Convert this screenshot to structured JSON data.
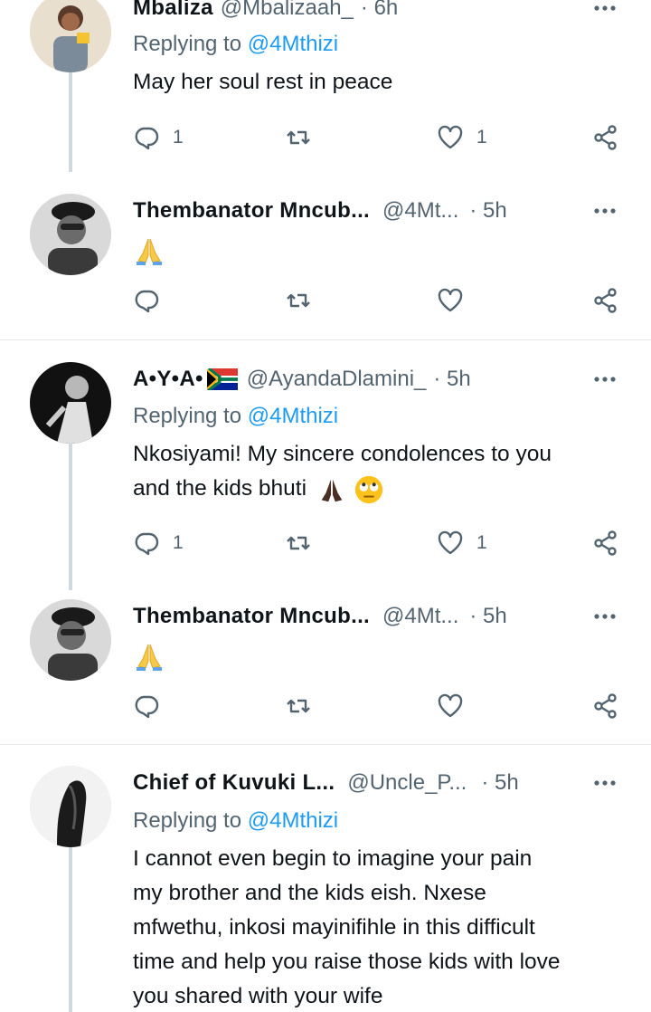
{
  "tweets": [
    {
      "name": "Mbaliza",
      "handle": "@Mbalizaah_",
      "time": "· 6h",
      "replying_prefix": "Replying to ",
      "replying_to": "@4Mthizi",
      "text": "May her soul rest in peace",
      "replies": "1",
      "retweets": "",
      "likes": "1"
    },
    {
      "name": "Thembanator Mncub...",
      "handle": "@4Mt...",
      "time": "· 5h",
      "emoji": "folded-hands",
      "replies": "",
      "retweets": "",
      "likes": ""
    },
    {
      "name": "A•Y•A•",
      "flag": "south-africa-flag",
      "handle": "@AyandaDlamini_",
      "time": "· 5h",
      "replying_prefix": "Replying to ",
      "replying_to": "@4Mthizi",
      "text_line1": "Nkosiyami! My sincere condolences to you",
      "text_line2": "and the kids bhuti",
      "replies": "1",
      "retweets": "",
      "likes": "1"
    },
    {
      "name": "Thembanator Mncub...",
      "handle": "@4Mt...",
      "time": "· 5h",
      "emoji": "folded-hands",
      "replies": "",
      "retweets": "",
      "likes": ""
    },
    {
      "name": "Chief of Kuvuki L...",
      "handle": "@Uncle_P...",
      "time": "· 5h",
      "replying_prefix": "Replying to ",
      "replying_to": "@4Mthizi",
      "text_lines": [
        "I cannot even begin to imagine your pain",
        "my brother and the kids eish. Nxese",
        "mfwethu, inkosi mayinifihle in this difficult",
        "time and help you raise those kids with love",
        "you shared with your wife"
      ]
    }
  ],
  "icons": {
    "reply": "reply-icon",
    "retweet": "retweet-icon",
    "like": "heart-icon",
    "share": "share-icon",
    "more": "more-icon"
  },
  "colors": {
    "link": "#1d9bf0",
    "muted": "#536471",
    "thread_line": "#cfd9de"
  }
}
